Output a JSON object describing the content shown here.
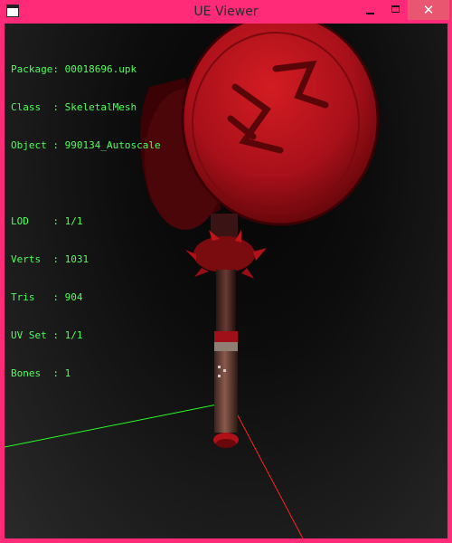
{
  "window": {
    "title": "UE Viewer"
  },
  "controls": {
    "minimize": "minimize",
    "maximize": "maximize",
    "close": "close"
  },
  "info": {
    "package": "Package: 00018696.upk",
    "class": "Class  : SkeletalMesh",
    "object": "Object : 990134_Autoscale",
    "lod": "LOD    : 1/1",
    "verts": "Verts  : 1031",
    "tris": "Tris   : 904",
    "uvset": "UV Set : 1/1",
    "bones": "Bones  : 1"
  },
  "colors": {
    "frame": "#ff2a78",
    "text": "#4cff5a",
    "axis_x": "#ff2020",
    "axis_y": "#22ff22",
    "mesh": "#c01418"
  },
  "icons": {
    "app": "window-app-icon",
    "close": "close-icon",
    "minimize": "minimize-icon",
    "maximize": "maximize-icon"
  }
}
